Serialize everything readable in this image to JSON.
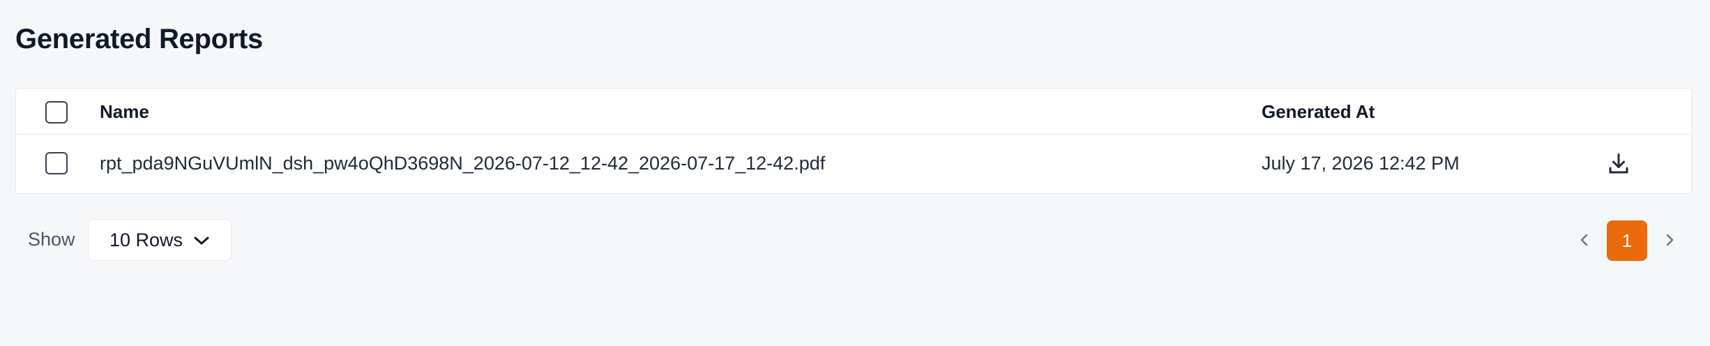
{
  "page": {
    "title": "Generated Reports"
  },
  "table": {
    "columns": {
      "name": "Name",
      "generated_at": "Generated At"
    },
    "rows": [
      {
        "name": "rpt_pda9NGuVUmlN_dsh_pw4oQhD3698N_2026-07-12_12-42_2026-07-17_12-42.pdf",
        "generated_at": "July 17, 2026 12:42 PM",
        "action_icon": "download-icon",
        "selected": false
      }
    ],
    "select_all_checked": false
  },
  "footer": {
    "show_label": "Show",
    "rows_select": {
      "selected": "10 Rows",
      "icon": "chevron-down-icon"
    },
    "pagination": {
      "current_page": "1",
      "prev_icon": "chevron-left-icon",
      "next_icon": "chevron-right-icon"
    }
  },
  "colors": {
    "background": "#f6f7f9",
    "accent": "#ea6a0c",
    "border": "#e5e7eb",
    "text": "#111827"
  }
}
